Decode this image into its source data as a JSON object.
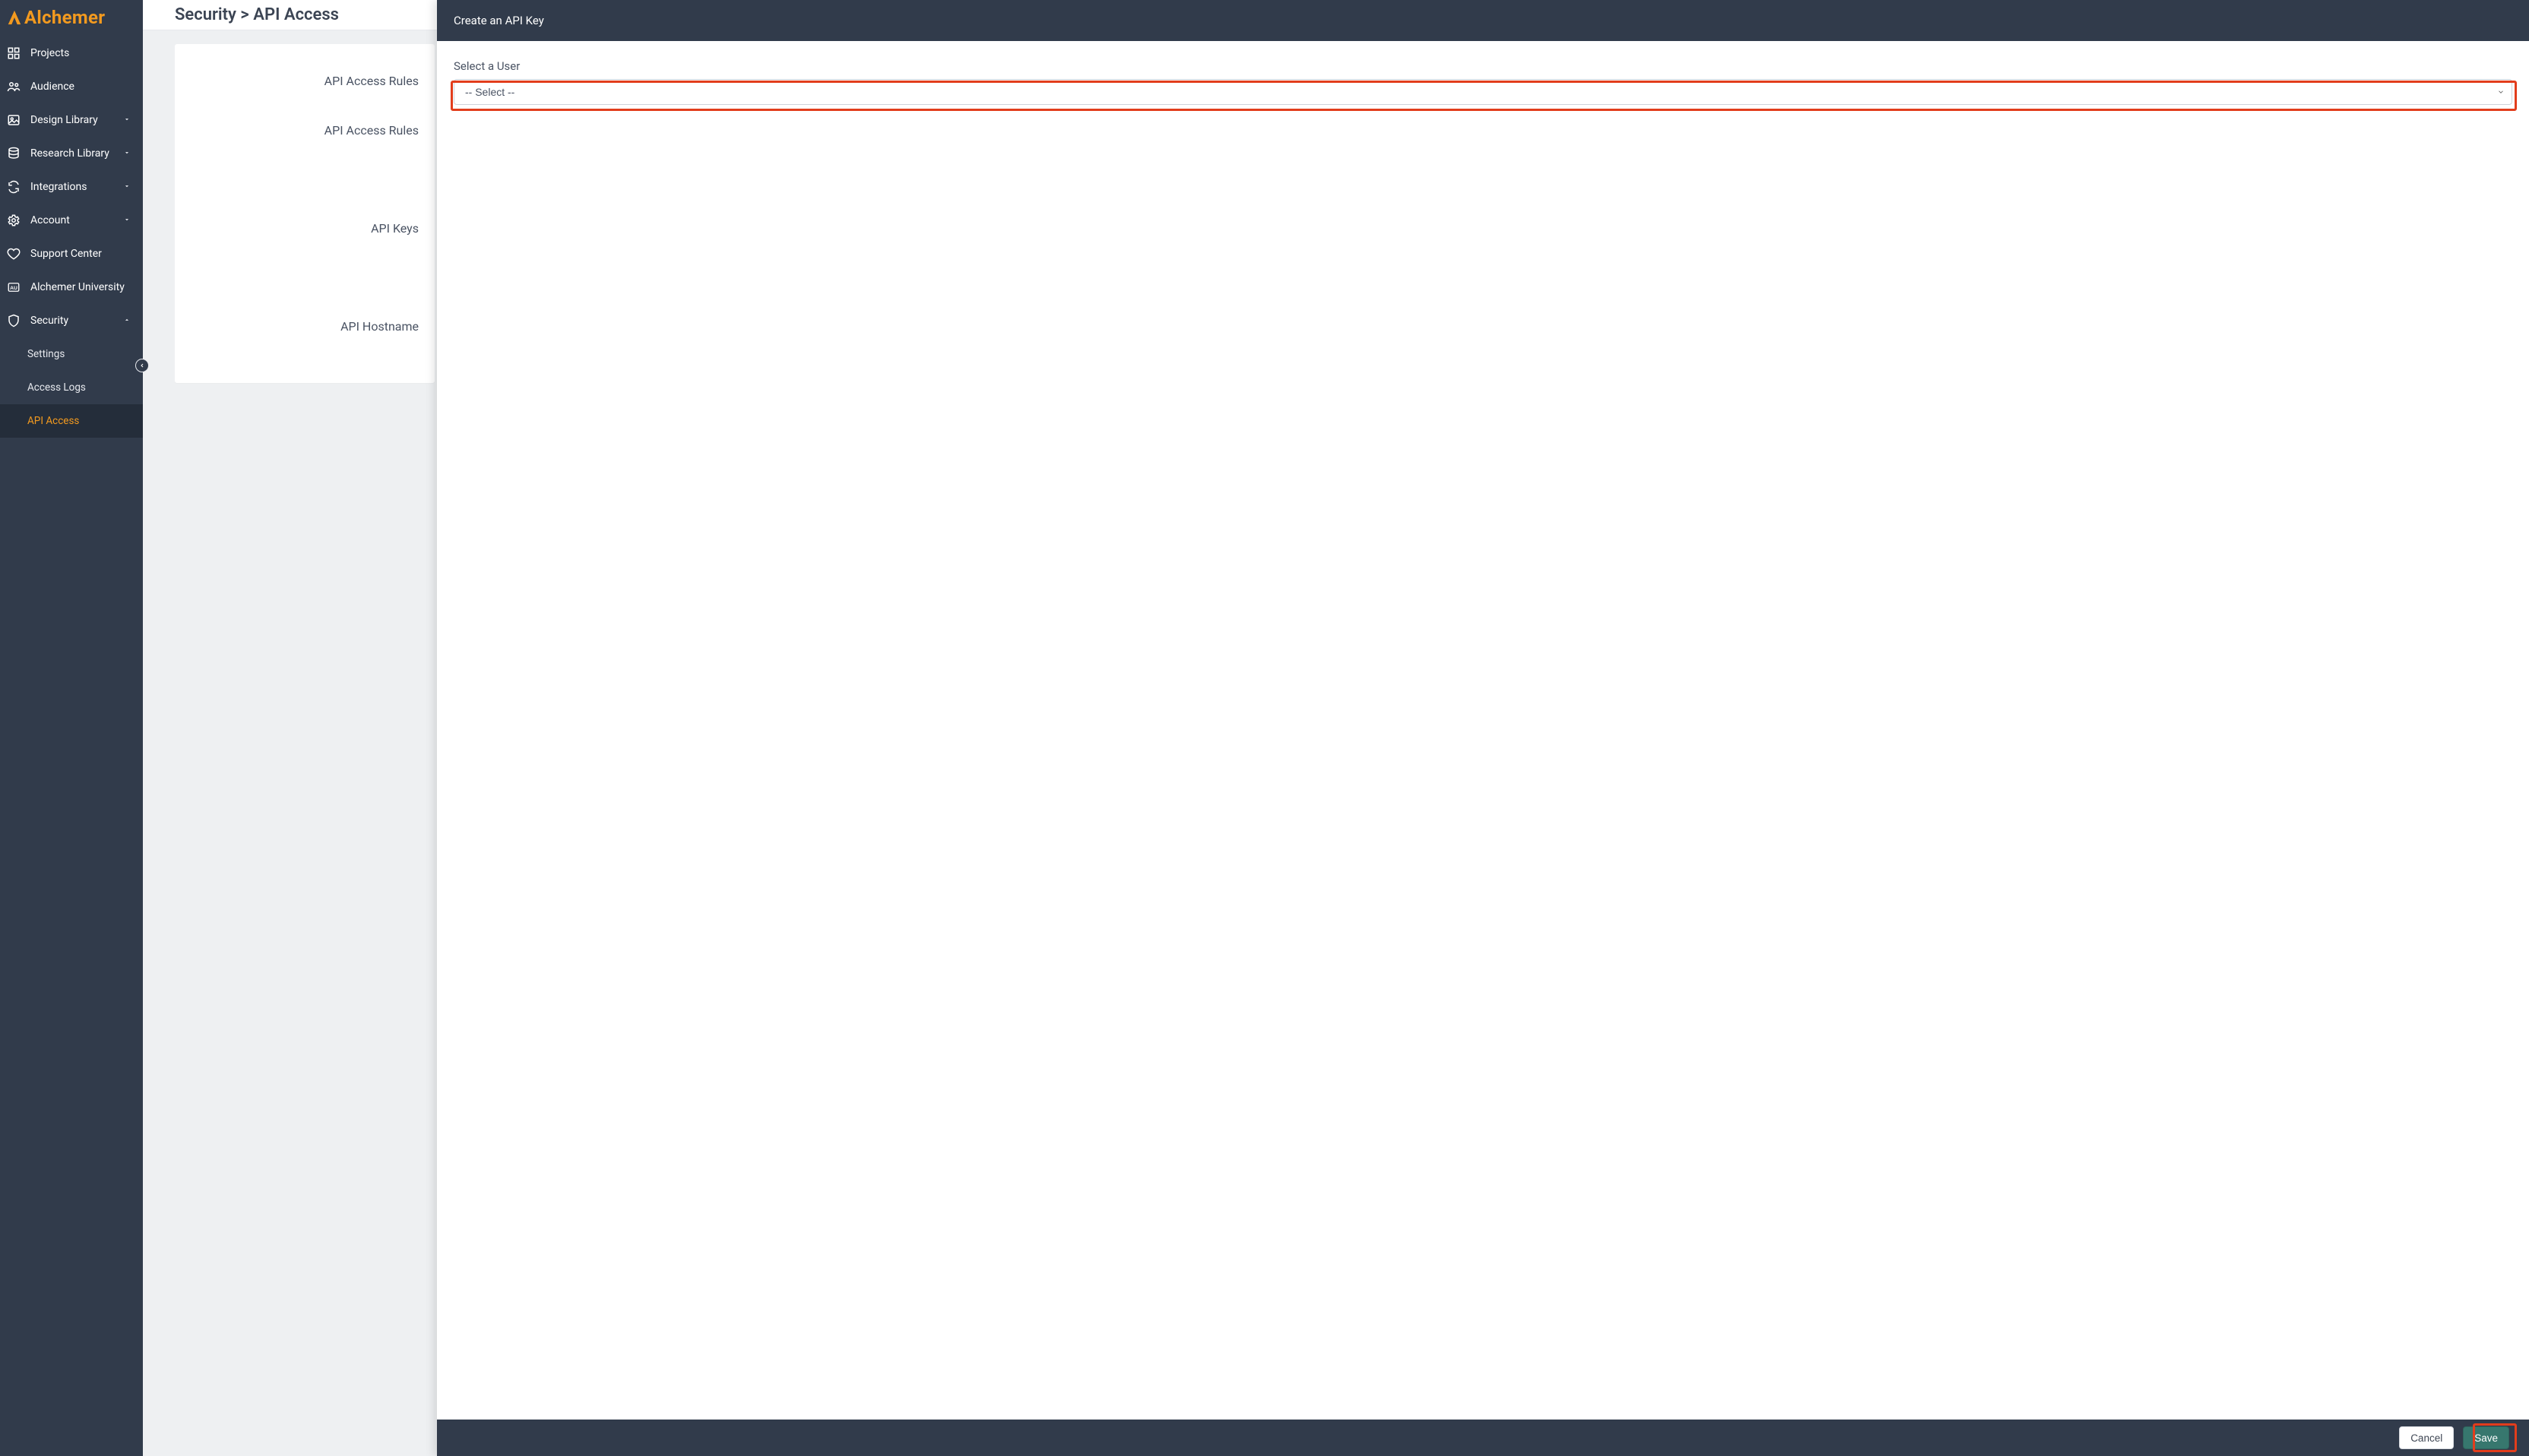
{
  "brand": {
    "name": "Alchemer"
  },
  "sidebar": {
    "items": [
      {
        "label": "Projects",
        "icon": "grid-icon",
        "expandable": false
      },
      {
        "label": "Audience",
        "icon": "people-icon",
        "expandable": false
      },
      {
        "label": "Design Library",
        "icon": "image-icon",
        "expandable": true,
        "expanded": false
      },
      {
        "label": "Research Library",
        "icon": "database-icon",
        "expandable": true,
        "expanded": false
      },
      {
        "label": "Integrations",
        "icon": "sync-icon",
        "expandable": true,
        "expanded": false
      },
      {
        "label": "Account",
        "icon": "gear-icon",
        "expandable": true,
        "expanded": false
      },
      {
        "label": "Support Center",
        "icon": "heart-icon",
        "expandable": false
      },
      {
        "label": "Alchemer University",
        "icon": "university-icon",
        "expandable": false
      },
      {
        "label": "Security",
        "icon": "shield-icon",
        "expandable": true,
        "expanded": true,
        "children": [
          {
            "label": "Settings",
            "active": false
          },
          {
            "label": "Access Logs",
            "active": false
          },
          {
            "label": "API Access",
            "active": true
          }
        ]
      }
    ]
  },
  "page": {
    "breadcrumb": "Security > API Access",
    "sections": [
      "API Access Rules",
      "API Access Rules",
      "API Keys",
      "API Hostname"
    ]
  },
  "panel": {
    "title": "Create an API Key",
    "user_field_label": "Select a User",
    "user_select_value": "-- Select --",
    "footer": {
      "cancel": "Cancel",
      "save": "Save"
    }
  },
  "colors": {
    "brand": "#f39a1f",
    "sidebar_bg": "#313b4b",
    "primary_btn": "#37776e",
    "highlight": "#e23d1c"
  }
}
